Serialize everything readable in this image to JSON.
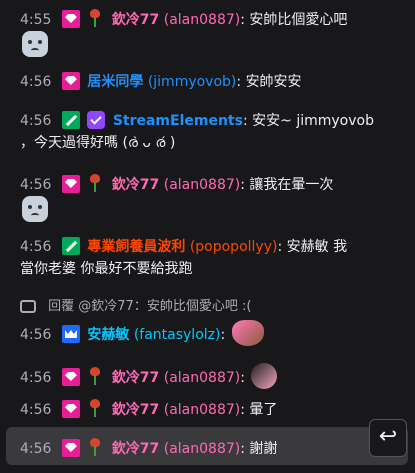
{
  "messages": [
    {
      "time": "4:55",
      "user": "欽冷77",
      "login": "(alan0887)",
      "text": "安帥比個愛心吧",
      "color": "#ff69b4",
      "emotes": [
        "face-emote"
      ]
    },
    {
      "time": "4:56",
      "user": "居米同學",
      "login": "(jimmyovob)",
      "text": "安帥安安",
      "color": "#1e90ff"
    },
    {
      "time": "4:56",
      "user": "StreamElements",
      "login": "",
      "text": "安安~ jimmyovob",
      "text2": "，今天過得好嗎 (ര̀ ᴗ ര́ )",
      "color": "#1e90ff"
    },
    {
      "time": "4:56",
      "user": "欽冷77",
      "login": "(alan0887)",
      "text": "讓我在暈一次",
      "color": "#ff69b4",
      "emotes": [
        "face-emote"
      ]
    },
    {
      "time": "4:56",
      "user": "專業飼養員波利",
      "login": "(popopollyy)",
      "text": "安赫敏 我",
      "text2": "當你老婆 你最好不要給我跑",
      "color": "#ff4500"
    },
    {
      "time": "4:56",
      "user": "安赫敏",
      "login": "(fantasylolz)",
      "text": "",
      "color": "#00c8ff",
      "emotes": [
        "heart-emote"
      ]
    },
    {
      "time": "4:56",
      "user": "欽冷77",
      "login": "(alan0887)",
      "text": "",
      "color": "#ff69b4",
      "emotes": [
        "cat-emote"
      ]
    },
    {
      "time": "4:56",
      "user": "欽冷77",
      "login": "(alan0887)",
      "text": "暈了",
      "color": "#ff69b4"
    },
    {
      "time": "4:56",
      "user": "欽冷77",
      "login": "(alan0887)",
      "text": "謝謝",
      "color": "#ff69b4"
    }
  ],
  "reply_context": "回覆 @欽冷77：安帥比個愛心吧 :(",
  "reply_button_icon": "reply-arrow-icon"
}
